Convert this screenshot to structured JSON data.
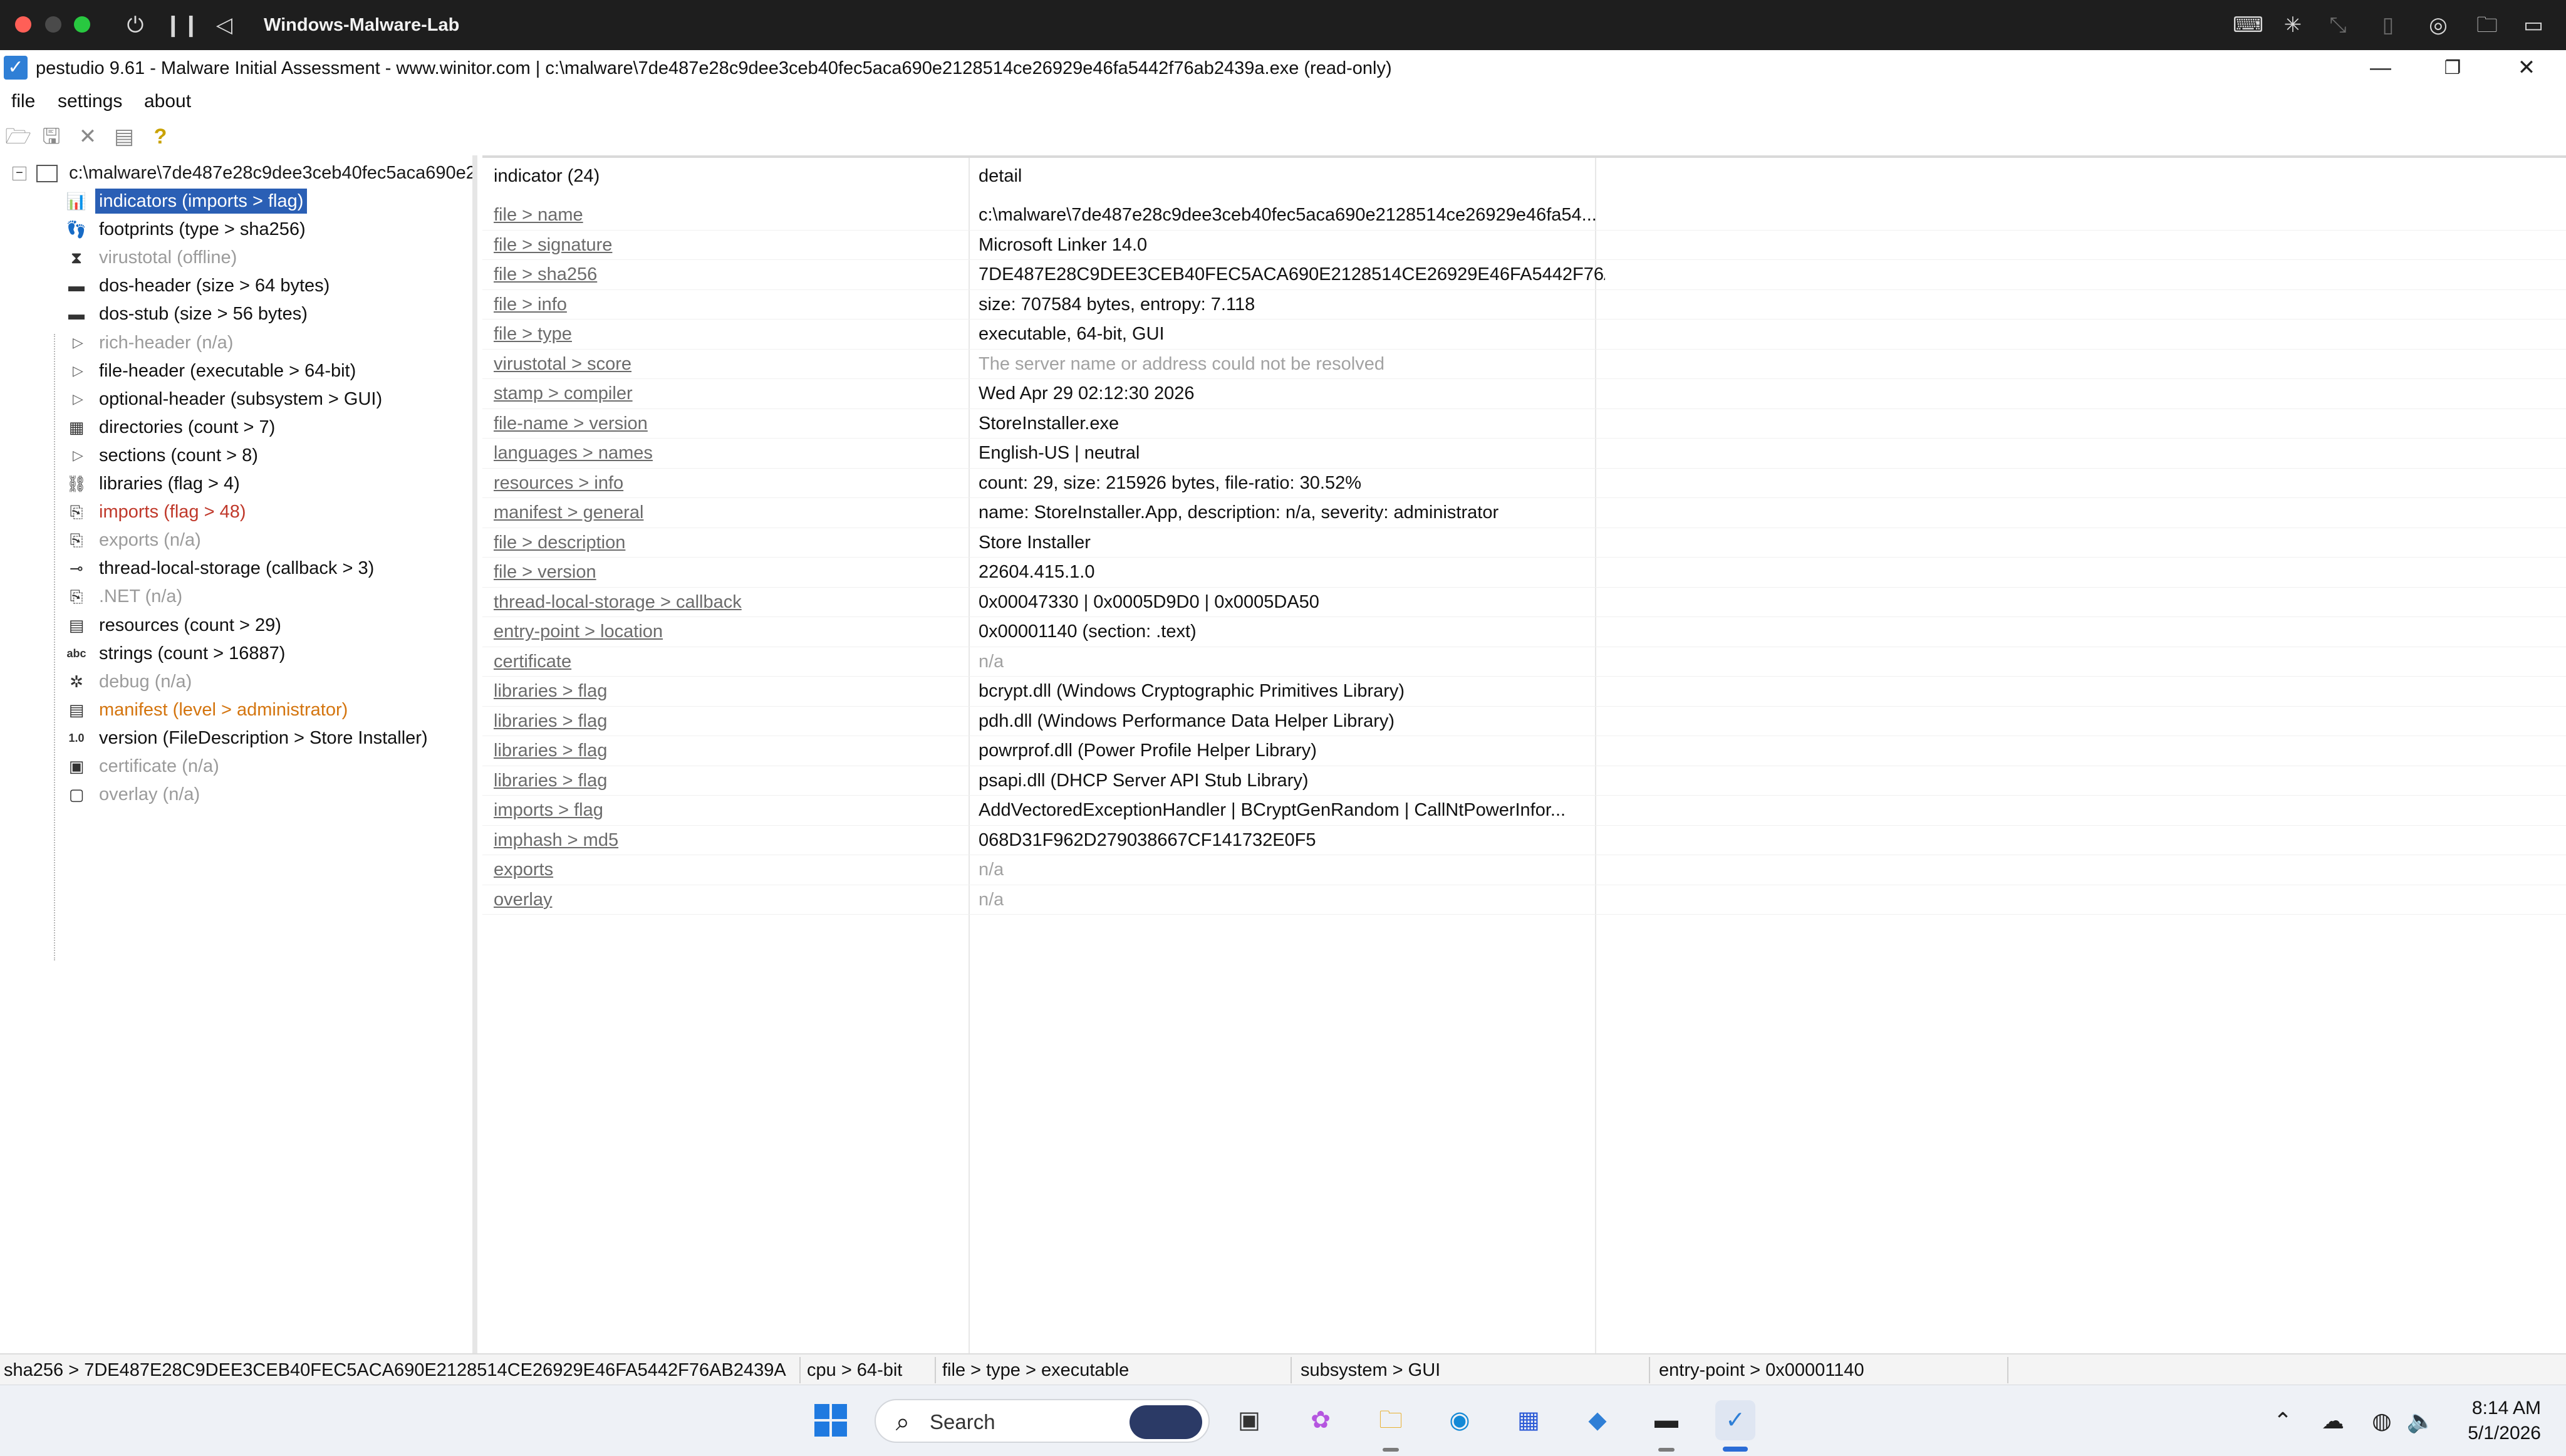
{
  "vm": {
    "title": "Windows-Malware-Lab"
  },
  "window": {
    "title": "pestudio 9.61 - Malware Initial Assessment - www.winitor.com | c:\\malware\\7de487e28c9dee3ceb40fec5aca690e2128514ce26929e46fa5442f76ab2439a.exe (read-only)",
    "minimize": "—",
    "restore": "❐",
    "close": "✕"
  },
  "menu": [
    "file",
    "settings",
    "about"
  ],
  "toolbar": {
    "icons": [
      "open-icon",
      "save-icon",
      "close-file-icon",
      "clipboard-icon",
      "help-icon"
    ]
  },
  "tree": {
    "root": "c:\\malware\\7de487e28c9dee3ceb40fec5aca690e2",
    "nodes": [
      {
        "label": "indicators (imports > flag)",
        "style": "sel",
        "glyph": "📊",
        "icon": "indicators-icon"
      },
      {
        "label": "footprints (type > sha256)",
        "style": "",
        "glyph": "👣",
        "icon": "footprints-icon"
      },
      {
        "label": "virustotal (offline)",
        "style": "grey",
        "glyph": "⧗",
        "icon": "virustotal-icon"
      },
      {
        "label": "dos-header (size > 64 bytes)",
        "style": "",
        "glyph": "▬",
        "icon": "dos-header-icon"
      },
      {
        "label": "dos-stub (size > 56 bytes)",
        "style": "",
        "glyph": "▬",
        "icon": "dos-stub-icon"
      },
      {
        "label": "rich-header (n/a)",
        "style": "grey",
        "glyph": "▷",
        "icon": "expand-icon"
      },
      {
        "label": "file-header (executable > 64-bit)",
        "style": "",
        "glyph": "▷",
        "icon": "expand-icon"
      },
      {
        "label": "optional-header (subsystem > GUI)",
        "style": "",
        "glyph": "▷",
        "icon": "expand-icon"
      },
      {
        "label": "directories (count > 7)",
        "style": "",
        "glyph": "▦",
        "icon": "directories-icon"
      },
      {
        "label": "sections (count > 8)",
        "style": "",
        "glyph": "▷",
        "icon": "expand-icon"
      },
      {
        "label": "libraries (flag > 4)",
        "style": "",
        "glyph": "⛓",
        "icon": "libraries-icon"
      },
      {
        "label": "imports (flag > 48)",
        "style": "red",
        "glyph": "⎘",
        "icon": "imports-icon"
      },
      {
        "label": "exports (n/a)",
        "style": "grey",
        "glyph": "⎘",
        "icon": "exports-icon"
      },
      {
        "label": "thread-local-storage (callback > 3)",
        "style": "",
        "glyph": "⊸",
        "icon": "tls-icon"
      },
      {
        "label": ".NET (n/a)",
        "style": "grey",
        "glyph": "⎘",
        "icon": "dotnet-icon"
      },
      {
        "label": "resources (count > 29)",
        "style": "",
        "glyph": "▤",
        "icon": "resources-icon"
      },
      {
        "label": "strings (count > 16887)",
        "style": "",
        "glyph": "abc",
        "icon": "strings-icon"
      },
      {
        "label": "debug (n/a)",
        "style": "grey",
        "glyph": "✲",
        "icon": "debug-icon"
      },
      {
        "label": "manifest (level > administrator)",
        "style": "orange",
        "glyph": "▤",
        "icon": "manifest-icon"
      },
      {
        "label": "version (FileDescription > Store Installer)",
        "style": "",
        "glyph": "1.0",
        "icon": "version-icon"
      },
      {
        "label": "certificate (n/a)",
        "style": "grey",
        "glyph": "▣",
        "icon": "certificate-icon"
      },
      {
        "label": "overlay (n/a)",
        "style": "grey",
        "glyph": "▢",
        "icon": "overlay-icon"
      }
    ]
  },
  "grid": {
    "headers": {
      "indicator": "indicator (24)",
      "detail": "detail"
    },
    "rows": [
      {
        "indicator": "file > name",
        "detail": "c:\\malware\\7de487e28c9dee3ceb40fec5aca690e2128514ce26929e46fa54...",
        "grey": false
      },
      {
        "indicator": "file > signature",
        "detail": "Microsoft Linker 14.0",
        "grey": false
      },
      {
        "indicator": "file > sha256",
        "detail": "7DE487E28C9DEE3CEB40FEC5ACA690E2128514CE26929E46FA5442F76AB...",
        "grey": false
      },
      {
        "indicator": "file > info",
        "detail": "size: 707584 bytes, entropy: 7.118",
        "grey": false
      },
      {
        "indicator": "file > type",
        "detail": "executable, 64-bit, GUI",
        "grey": false
      },
      {
        "indicator": "virustotal > score",
        "detail": "The server name or address could not be resolved",
        "grey": true
      },
      {
        "indicator": "stamp > compiler",
        "detail": "Wed Apr 29 02:12:30 2026",
        "grey": false
      },
      {
        "indicator": "file-name > version",
        "detail": "StoreInstaller.exe",
        "grey": false
      },
      {
        "indicator": "languages > names",
        "detail": "English-US | neutral",
        "grey": false
      },
      {
        "indicator": "resources > info",
        "detail": "count: 29, size: 215926 bytes, file-ratio: 30.52%",
        "grey": false
      },
      {
        "indicator": "manifest > general",
        "detail": "name: StoreInstaller.App, description: n/a, severity: administrator",
        "grey": false
      },
      {
        "indicator": "file > description",
        "detail": "Store Installer",
        "grey": false
      },
      {
        "indicator": "file > version",
        "detail": "22604.415.1.0",
        "grey": false
      },
      {
        "indicator": "thread-local-storage > callback",
        "detail": "0x00047330 | 0x0005D9D0 | 0x0005DA50",
        "grey": false
      },
      {
        "indicator": "entry-point > location",
        "detail": "0x00001140 (section: .text)",
        "grey": false
      },
      {
        "indicator": "certificate",
        "detail": "n/a",
        "grey": true
      },
      {
        "indicator": "libraries > flag",
        "detail": "bcrypt.dll (Windows Cryptographic Primitives Library)",
        "grey": false
      },
      {
        "indicator": "libraries > flag",
        "detail": "pdh.dll (Windows Performance Data Helper Library)",
        "grey": false
      },
      {
        "indicator": "libraries > flag",
        "detail": "powrprof.dll (Power Profile Helper Library)",
        "grey": false
      },
      {
        "indicator": "libraries > flag",
        "detail": "psapi.dll (DHCP Server API Stub Library)",
        "grey": false
      },
      {
        "indicator": "imports > flag",
        "detail": "AddVectoredExceptionHandler | BCryptGenRandom | CallNtPowerInfor...",
        "grey": false
      },
      {
        "indicator": "imphash > md5",
        "detail": "068D31F962D279038667CF141732E0F5",
        "grey": false
      },
      {
        "indicator": "exports",
        "detail": "n/a",
        "grey": true
      },
      {
        "indicator": "overlay",
        "detail": "n/a",
        "grey": true
      }
    ]
  },
  "status": {
    "sha256": "sha256 > 7DE487E28C9DEE3CEB40FEC5ACA690E2128514CE26929E46FA5442F76AB2439A",
    "cpu": "cpu > 64-bit",
    "type": "file > type > executable",
    "subsystem": "subsystem > GUI",
    "entry": "entry-point > 0x00001140"
  },
  "taskbar": {
    "search_placeholder": "Search",
    "time": "8:14 AM",
    "date": "5/1/2026"
  },
  "colors": {
    "selection": "#2a5fb5",
    "flag_red": "#c0392b",
    "flag_orange": "#d4750f",
    "disabled_grey": "#9b9b9b"
  }
}
